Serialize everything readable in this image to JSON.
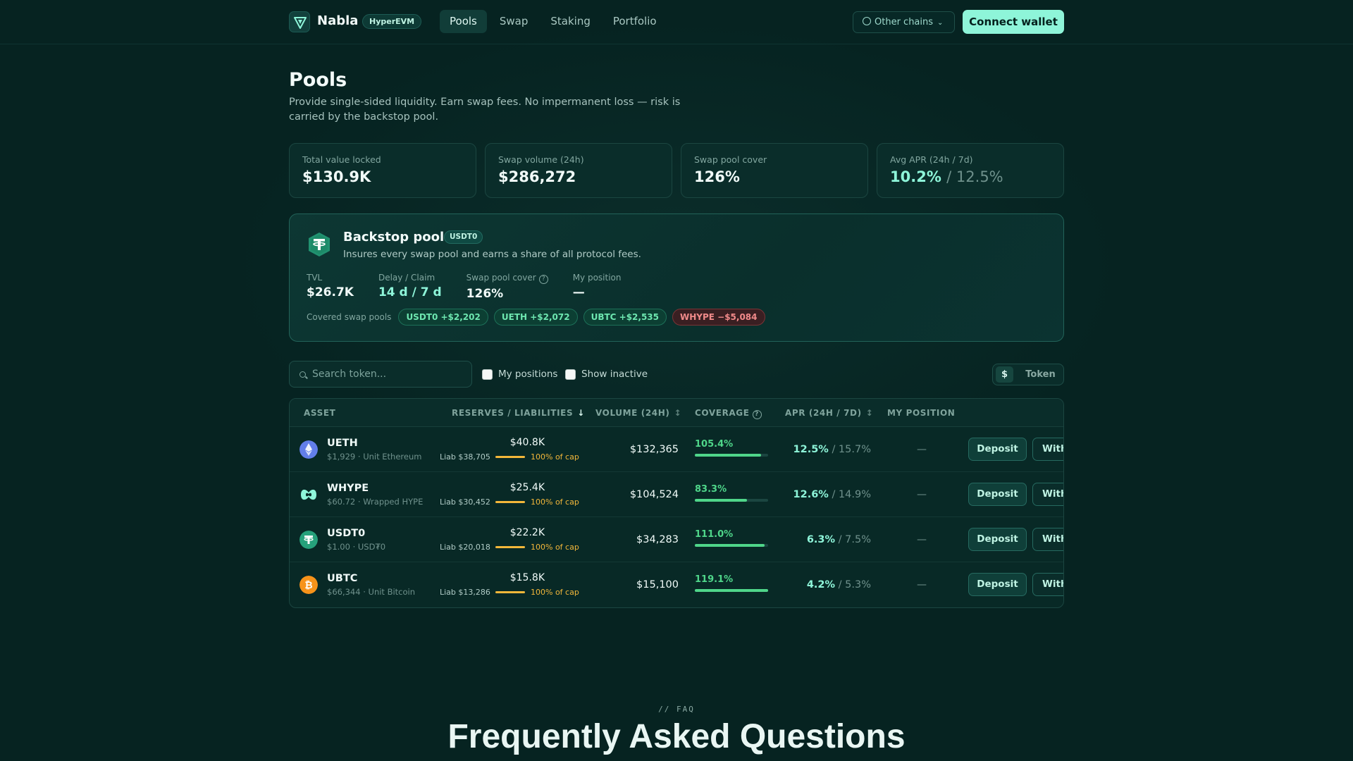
{
  "nav": {
    "brand": "Nabla",
    "chain_badge": "HyperEVM",
    "links": [
      "Pools",
      "Swap",
      "Staking",
      "Portfolio"
    ],
    "active_link": "Pools",
    "chains_button": "Other chains",
    "connect_button": "Connect wallet",
    "icons": {
      "logo": "nabla-logo-icon",
      "globe": "globe-icon",
      "chevron": "chevron-down-icon"
    }
  },
  "header": {
    "title": "Pools",
    "subtitle": "Provide single-sided liquidity. Earn swap fees. No impermanent loss — risk is carried by the backstop pool."
  },
  "stats": [
    {
      "label": "Total value locked",
      "value": "$130.9K"
    },
    {
      "label": "Swap volume (24h)",
      "value": "$286,272"
    },
    {
      "label": "Swap pool cover",
      "value": "126%"
    },
    {
      "label": "Avg APR (24h / 7d)",
      "value_primary": "10.2%",
      "value_secondary": "/ 12.5%"
    }
  ],
  "backstop": {
    "title": "Backstop pool",
    "badge": "USDT0",
    "description": "Insures every swap pool and earns a share of all protocol fees.",
    "metrics": [
      {
        "label": "TVL",
        "value": "$26.7K"
      },
      {
        "label": "Delay / Claim",
        "value": "14 d / 7 d"
      },
      {
        "label": "Swap pool cover",
        "value": "126%"
      },
      {
        "label": "My position",
        "value": "—"
      }
    ],
    "covered_label": "Covered swap pools",
    "covered": [
      {
        "label": "USDT0 +$2,202",
        "tone": "positive"
      },
      {
        "label": "UETH +$2,072",
        "tone": "positive"
      },
      {
        "label": "UBTC +$2,535",
        "tone": "positive"
      },
      {
        "label": "WHYPE −$5,084",
        "tone": "negative"
      }
    ]
  },
  "filters": {
    "search_placeholder": "Search token...",
    "my_positions": "My positions",
    "show_inactive": "Show inactive",
    "unit_options": [
      "$",
      "Token"
    ],
    "unit_selected": "$"
  },
  "table": {
    "columns": [
      "ASSET",
      "RESERVES / LIABILITIES",
      "VOLUME (24H)",
      "COVERAGE",
      "APR (24H / 7D)",
      "MY POSITION"
    ],
    "sort_indicators": [
      "↓",
      "↕",
      "↕"
    ],
    "deposit_label": "Deposit",
    "withdraw_label": "Withdraw",
    "rows": [
      {
        "symbol": "UETH",
        "sub": "$1,929 · Unit Ethereum",
        "reserves": "$40.8K",
        "liab": "Liab $38,705",
        "cap": "100% of cap",
        "cap_fraction": 1.0,
        "volume": "$132,365",
        "coverage": "105.4%",
        "coverage_fraction": 0.9,
        "apr_24h": "12.5%",
        "apr_7d": "/ 15.7%",
        "position": "—",
        "icon": "ethereum-icon",
        "color": "#627eea"
      },
      {
        "symbol": "WHYPE",
        "sub": "$60.72 · Wrapped HYPE",
        "reserves": "$25.4K",
        "liab": "Liab $30,452",
        "cap": "100% of cap",
        "cap_fraction": 1.0,
        "volume": "$104,524",
        "coverage": "83.3%",
        "coverage_fraction": 0.71,
        "apr_24h": "12.6%",
        "apr_7d": "/ 14.9%",
        "position": "—",
        "icon": "hype-icon",
        "color": "#8ef5d9"
      },
      {
        "symbol": "USDT0",
        "sub": "$1.00 · USD₮0",
        "reserves": "$22.2K",
        "liab": "Liab $20,018",
        "cap": "100% of cap",
        "cap_fraction": 1.0,
        "volume": "$34,283",
        "coverage": "111.0%",
        "coverage_fraction": 0.95,
        "apr_24h": "6.3%",
        "apr_7d": "/ 7.5%",
        "position": "—",
        "icon": "tether-icon",
        "color": "#26a17b"
      },
      {
        "symbol": "UBTC",
        "sub": "$66,344 · Unit Bitcoin",
        "reserves": "$15.8K",
        "liab": "Liab $13,286",
        "cap": "100% of cap",
        "cap_fraction": 1.0,
        "volume": "$15,100",
        "coverage": "119.1%",
        "coverage_fraction": 1.0,
        "apr_24h": "4.2%",
        "apr_7d": "/ 5.3%",
        "position": "—",
        "icon": "bitcoin-icon",
        "color": "#f7931a"
      }
    ]
  },
  "faq": {
    "kicker": "// FAQ",
    "title": "Frequently Asked Questions"
  },
  "colors": {
    "background": "#062321",
    "accent": "#8ef5d9",
    "positive": "#4fd68a",
    "warning": "#f3b73a",
    "negative": "#f08a8a"
  }
}
